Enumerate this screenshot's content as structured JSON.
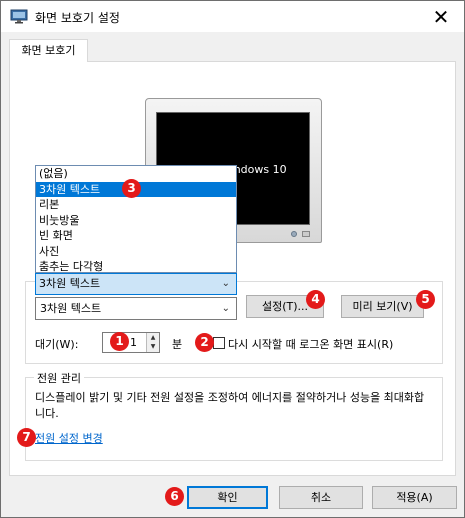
{
  "window": {
    "title": "화면 보호기 설정",
    "close_glyph": "✕"
  },
  "tab": {
    "label": "화면 보호기"
  },
  "preview": {
    "screen_text": "Windows 10"
  },
  "screensaver": {
    "options": [
      "(없음)",
      "3차원 텍스트",
      "리본",
      "비눗방울",
      "빈 화면",
      "사진",
      "춤추는 다각형"
    ],
    "highlighted": "3차원 텍스트",
    "combo_value": "3차원 텍스트",
    "selected": "3차원 텍스트",
    "settings_button": "설정(T)...",
    "preview_button": "미리 보기(V)"
  },
  "wait": {
    "label": "대기(W):",
    "value": "1",
    "unit": "분"
  },
  "logon": {
    "label": "다시 시작할 때 로그온 화면 표시(R)",
    "checked": false
  },
  "power": {
    "group_title": "전원 관리",
    "description": "디스플레이 밝기 및 기타 전원 설정을 조정하여 에너지를 절약하거나 성능을 최대화합니다.",
    "link": "전원 설정 변경"
  },
  "footer": {
    "ok": "확인",
    "cancel": "취소",
    "apply": "적용(A)"
  },
  "badges": [
    "1",
    "2",
    "3",
    "4",
    "5",
    "6",
    "7"
  ],
  "colors": {
    "badge": "#e31a1a",
    "highlight": "#0078d7",
    "link": "#0066cc"
  }
}
